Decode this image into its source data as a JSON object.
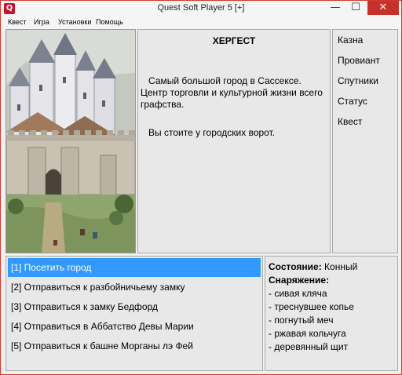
{
  "window": {
    "title": "Quest Soft Player 5 [+]",
    "app_icon_glyph": "Q",
    "minimize_glyph": "—",
    "maximize_glyph": "☐",
    "close_glyph": "✕",
    "accent_color": "#c7302b"
  },
  "menu": {
    "items": [
      {
        "label": "Квест"
      },
      {
        "label": "Игра"
      },
      {
        "label": "Установки"
      },
      {
        "label": "Помощь"
      }
    ]
  },
  "picture": {
    "icon": "castle-illustration"
  },
  "story": {
    "title": "ХЕРГЕСТ",
    "paragraphs": [
      "   Самый большой город в Сассексе. Центр торговли и культурной жизни всего графства.",
      "   Вы стоите у городских ворот."
    ]
  },
  "side_menu": {
    "items": [
      {
        "label": "Казна"
      },
      {
        "label": "Провиант"
      },
      {
        "label": "Спутники"
      },
      {
        "label": "Статус"
      },
      {
        "label": "Квест"
      }
    ]
  },
  "choices": {
    "selected_index": 0,
    "selected_color": "#3399ff",
    "items": [
      {
        "label": "[1] Посетить город"
      },
      {
        "label": "[2] Отправиться к разбойничьему замку"
      },
      {
        "label": "[3] Отправиться к замку Бедфорд"
      },
      {
        "label": "[4] Отправиться в Аббатство Девы Марии"
      },
      {
        "label": "[5] Отправиться к башне Морганы лэ Фей"
      }
    ]
  },
  "status": {
    "state_label": "Состояние:",
    "state_value": " Конный",
    "equipment_label": "Снаряжение:",
    "equipment": [
      "- сивая кляча",
      "- треснувшее копье",
      "- погнутый меч",
      "- ржавая кольчуга",
      "- деревянный щит"
    ]
  }
}
